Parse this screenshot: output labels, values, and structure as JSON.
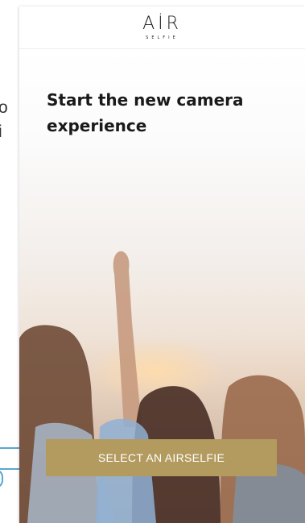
{
  "background": {
    "fragment_1": "o",
    "fragment_2": "i"
  },
  "app": {
    "logo_main": "AİR",
    "logo_sub": "SELFIE"
  },
  "hero": {
    "headline": "Start the new camera experience"
  },
  "actions": {
    "primary_label": "SELECT AN AIRSELFIE"
  },
  "colors": {
    "accent": "#b39a5e",
    "connector": "#58a6d0"
  }
}
